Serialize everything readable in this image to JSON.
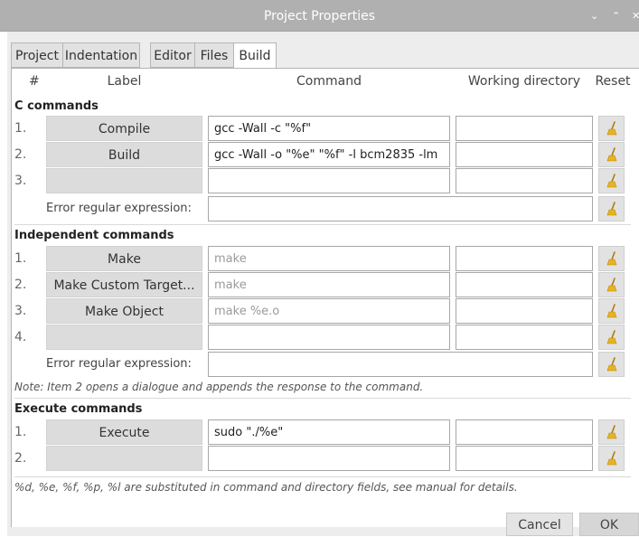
{
  "window": {
    "title": "Project Properties",
    "controls": [
      "⌄",
      "⌃",
      "✕"
    ]
  },
  "tabs": [
    {
      "label": "Project",
      "active": false
    },
    {
      "label": "Indentation",
      "active": false
    },
    {
      "label": "Editor",
      "active": false
    },
    {
      "label": "Files",
      "active": false
    },
    {
      "label": "Build",
      "active": true
    }
  ],
  "columns": {
    "num": "#",
    "label": "Label",
    "command": "Command",
    "workdir": "Working directory",
    "reset": "Reset"
  },
  "c_commands": {
    "heading": "C commands",
    "rows": [
      {
        "num": "1.",
        "label": "Compile",
        "command": "gcc -Wall -c \"%f\"",
        "placeholder": "",
        "workdir": ""
      },
      {
        "num": "2.",
        "label": "Build",
        "command": "gcc -Wall -o \"%e\" \"%f\" -l bcm2835 -lm",
        "placeholder": "",
        "workdir": ""
      },
      {
        "num": "3.",
        "label": "",
        "command": "",
        "placeholder": "",
        "workdir": ""
      }
    ],
    "error_label": "Error regular expression:",
    "error_value": ""
  },
  "independent_commands": {
    "heading": "Independent commands",
    "rows": [
      {
        "num": "1.",
        "label": "Make",
        "command": "",
        "placeholder": "make",
        "workdir": ""
      },
      {
        "num": "2.",
        "label": "Make Custom Target...",
        "command": "",
        "placeholder": "make",
        "workdir": ""
      },
      {
        "num": "3.",
        "label": "Make Object",
        "command": "",
        "placeholder": "make %e.o",
        "workdir": ""
      },
      {
        "num": "4.",
        "label": "",
        "command": "",
        "placeholder": "",
        "workdir": ""
      }
    ],
    "error_label": "Error regular expression:",
    "error_value": "",
    "note": "Note: Item 2 opens a dialogue and appends the response to the command."
  },
  "execute_commands": {
    "heading": "Execute commands",
    "rows": [
      {
        "num": "1.",
        "label": "Execute",
        "command": "sudo \"./%e\"",
        "placeholder": "",
        "workdir": ""
      },
      {
        "num": "2.",
        "label": "",
        "command": "",
        "placeholder": "",
        "workdir": ""
      }
    ]
  },
  "footer_note": "%d, %e, %f, %p, %l are substituted in command and directory fields, see manual for details.",
  "buttons": {
    "cancel": "Cancel",
    "ok": "OK"
  },
  "icons": {
    "reset": "broom-icon"
  },
  "colors": {
    "titlebar": "#b0b0b0",
    "label_button": "#dcdcdc",
    "broom": "#e6b422"
  }
}
